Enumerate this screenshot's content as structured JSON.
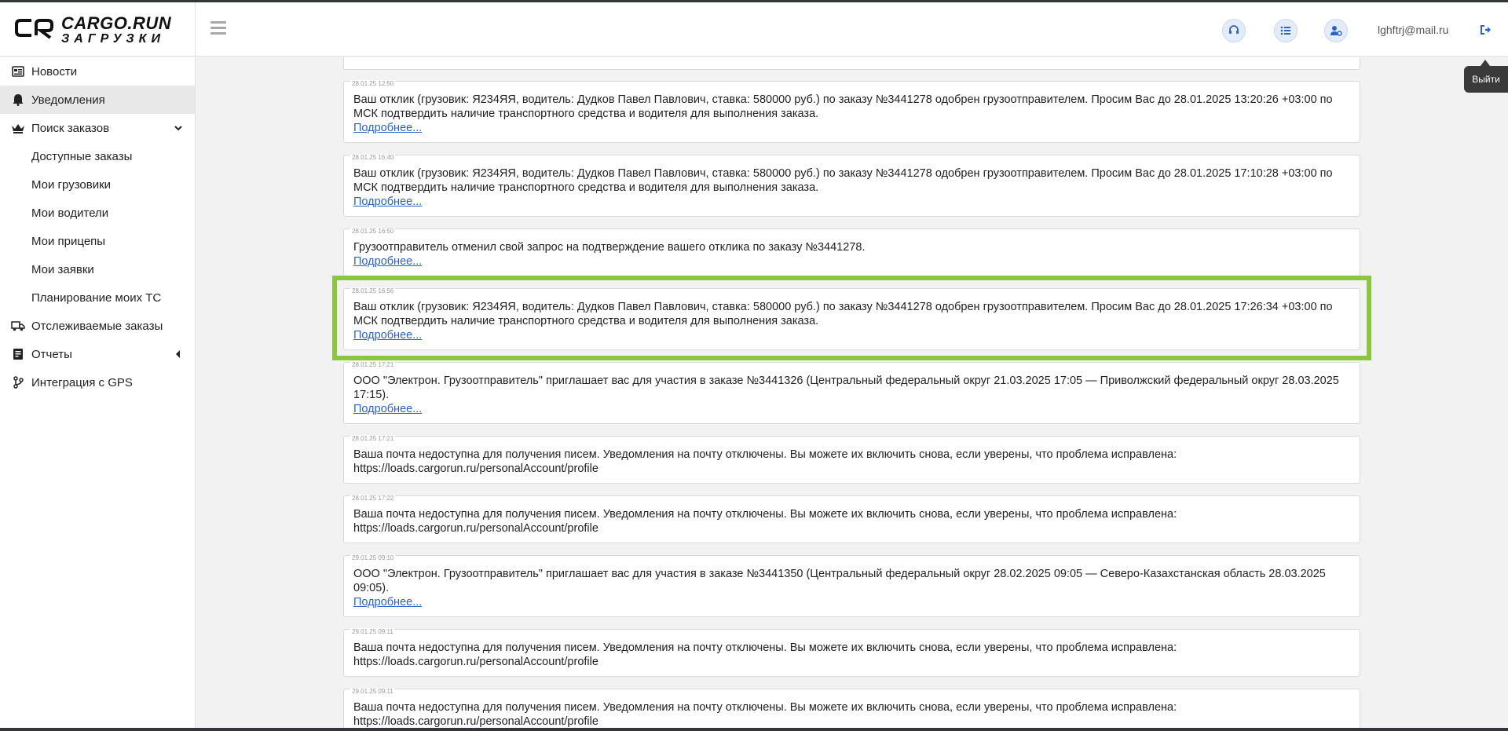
{
  "header": {
    "logo_title": "CARGO.RUN",
    "logo_subtitle": "ЗАГРУЗКИ",
    "user_email": "lghftrj@mail.ru",
    "logout_tooltip": "Выйти",
    "icons": [
      "support-icon",
      "list-icon",
      "user-settings-icon",
      "logout-icon"
    ]
  },
  "sidebar": {
    "items": [
      {
        "label": "Новости",
        "icon": "news-icon"
      },
      {
        "label": "Уведомления",
        "icon": "bell-icon",
        "active": true
      },
      {
        "label": "Поиск заказов",
        "icon": "crown-icon",
        "expanded": true
      },
      {
        "label": "Доступные заказы"
      },
      {
        "label": "Мои грузовики"
      },
      {
        "label": "Мои водители"
      },
      {
        "label": "Мои прицепы"
      },
      {
        "label": "Мои заявки"
      },
      {
        "label": "Планирование моих ТС"
      },
      {
        "label": "Отслеживаемые заказы",
        "icon": "truck-icon"
      },
      {
        "label": "Отчеты",
        "icon": "report-icon"
      },
      {
        "label": "Интеграция с GPS",
        "icon": "branch-icon"
      }
    ]
  },
  "notifications": [
    {
      "time": "28.01.25 12:50",
      "text": "Ваш отклик (грузовик: Я234ЯЯ, водитель: Дудков Павел Павлович, ставка: 580000 руб.) по заказу №3441278 одобрен грузоотправителем. Просим Вас до 28.01.2025 13:20:26 +03:00 по МСК подтвердить наличие транспортного средства и водителя для выполнения заказа.",
      "more": "Подробнее..."
    },
    {
      "time": "28.01.25 16:40",
      "text": "Ваш отклик (грузовик: Я234ЯЯ, водитель: Дудков Павел Павлович, ставка: 580000 руб.) по заказу №3441278 одобрен грузоотправителем. Просим Вас до 28.01.2025 17:10:28 +03:00 по МСК подтвердить наличие транспортного средства и водителя для выполнения заказа.",
      "more": "Подробнее..."
    },
    {
      "time": "28.01.25 16:50",
      "text": "Грузоотправитель отменил свой запрос на подтверждение вашего отклика по заказу №3441278.",
      "more": "Подробнее..."
    },
    {
      "time": "28.01.25 16:56",
      "text": "Ваш отклик (грузовик: Я234ЯЯ, водитель: Дудков Павел Павлович, ставка: 580000 руб.) по заказу №3441278 одобрен грузоотправителем. Просим Вас до 28.01.2025 17:26:34 +03:00 по МСК подтвердить наличие транспортного средства и водителя для выполнения заказа.",
      "more": "Подробнее..."
    },
    {
      "time": "28.01.25 17:21",
      "text": "ООО \"Электрон. Грузоотправитель\" приглашает вас для участия в заказе №3441326 (Центральный федеральный округ 21.03.2025 17:05 — Приволжский федеральный округ 28.03.2025 17:15).",
      "more": "Подробнее..."
    },
    {
      "time": "28.01.25 17:21",
      "text": "Ваша почта недоступна для получения писем. Уведомления на почту отключены. Вы можете их включить снова, если уверены, что проблема исправлена: https://loads.cargorun.ru/personalAccount/profile",
      "more": ""
    },
    {
      "time": "28.01.25 17:22",
      "text": "Ваша почта недоступна для получения писем. Уведомления на почту отключены. Вы можете их включить снова, если уверены, что проблема исправлена: https://loads.cargorun.ru/personalAccount/profile",
      "more": ""
    },
    {
      "time": "29.01.25 09:10",
      "text": "ООО \"Электрон. Грузоотправитель\" приглашает вас для участия в заказе №3441350 (Центральный федеральный округ 28.02.2025 09:05 — Северо-Казахстанская область 28.03.2025 09:05).",
      "more": "Подробнее..."
    },
    {
      "time": "29.01.25 09:11",
      "text": "Ваша почта недоступна для получения писем. Уведомления на почту отключены. Вы можете их включить снова, если уверены, что проблема исправлена: https://loads.cargorun.ru/personalAccount/profile",
      "more": ""
    },
    {
      "time": "29.01.25 09:11",
      "text": "Ваша почта недоступна для получения писем. Уведомления на почту отключены. Вы можете их включить снова, если уверены, что проблема исправлена: https://loads.cargorun.ru/personalAccount/profile",
      "more": ""
    }
  ],
  "colors": {
    "highlight": "#8cc63f",
    "link": "#2a63c9",
    "active_nav": "#e8e8e8"
  }
}
